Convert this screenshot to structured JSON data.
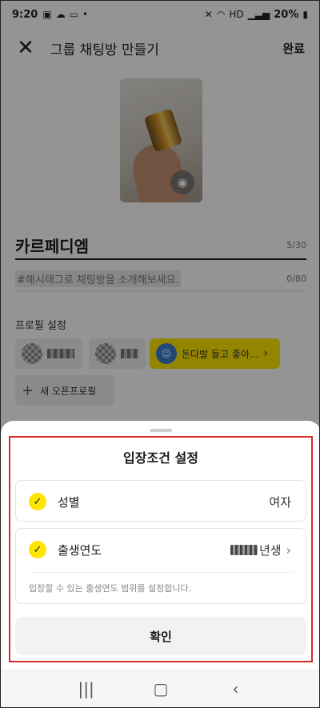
{
  "status_bar": {
    "time": "9:20",
    "left_icons": [
      "image-icon",
      "cloud-icon",
      "chat-icon",
      "dot-icon"
    ],
    "right_text": "HD",
    "battery": "20%"
  },
  "app_bar": {
    "close_icon": "close-icon",
    "title": "그룹 채팅방 만들기",
    "done_label": "완료"
  },
  "room": {
    "name": "카르페디엠",
    "name_count": "5/30",
    "description_placeholder": "#해시태그로 채팅방을 소개해보세요.",
    "description_count": "0/80"
  },
  "profile": {
    "label": "프로필 설정",
    "chips": [
      {
        "label": ""
      },
      {
        "label": ""
      },
      {
        "label": "돈다발 들고 좋아..."
      }
    ],
    "new_profile_label": "새 오픈프로필"
  },
  "sheet": {
    "title": "입장조건 설정",
    "gender": {
      "label": "성별",
      "value": "여자"
    },
    "birth": {
      "label": "출생연도",
      "value_suffix": "년생",
      "note": "입장할 수 있는 출생연도 범위를 설정합니다."
    },
    "confirm_label": "확인"
  },
  "colors": {
    "accent": "#fee500",
    "highlight_border": "#d52b2b"
  }
}
